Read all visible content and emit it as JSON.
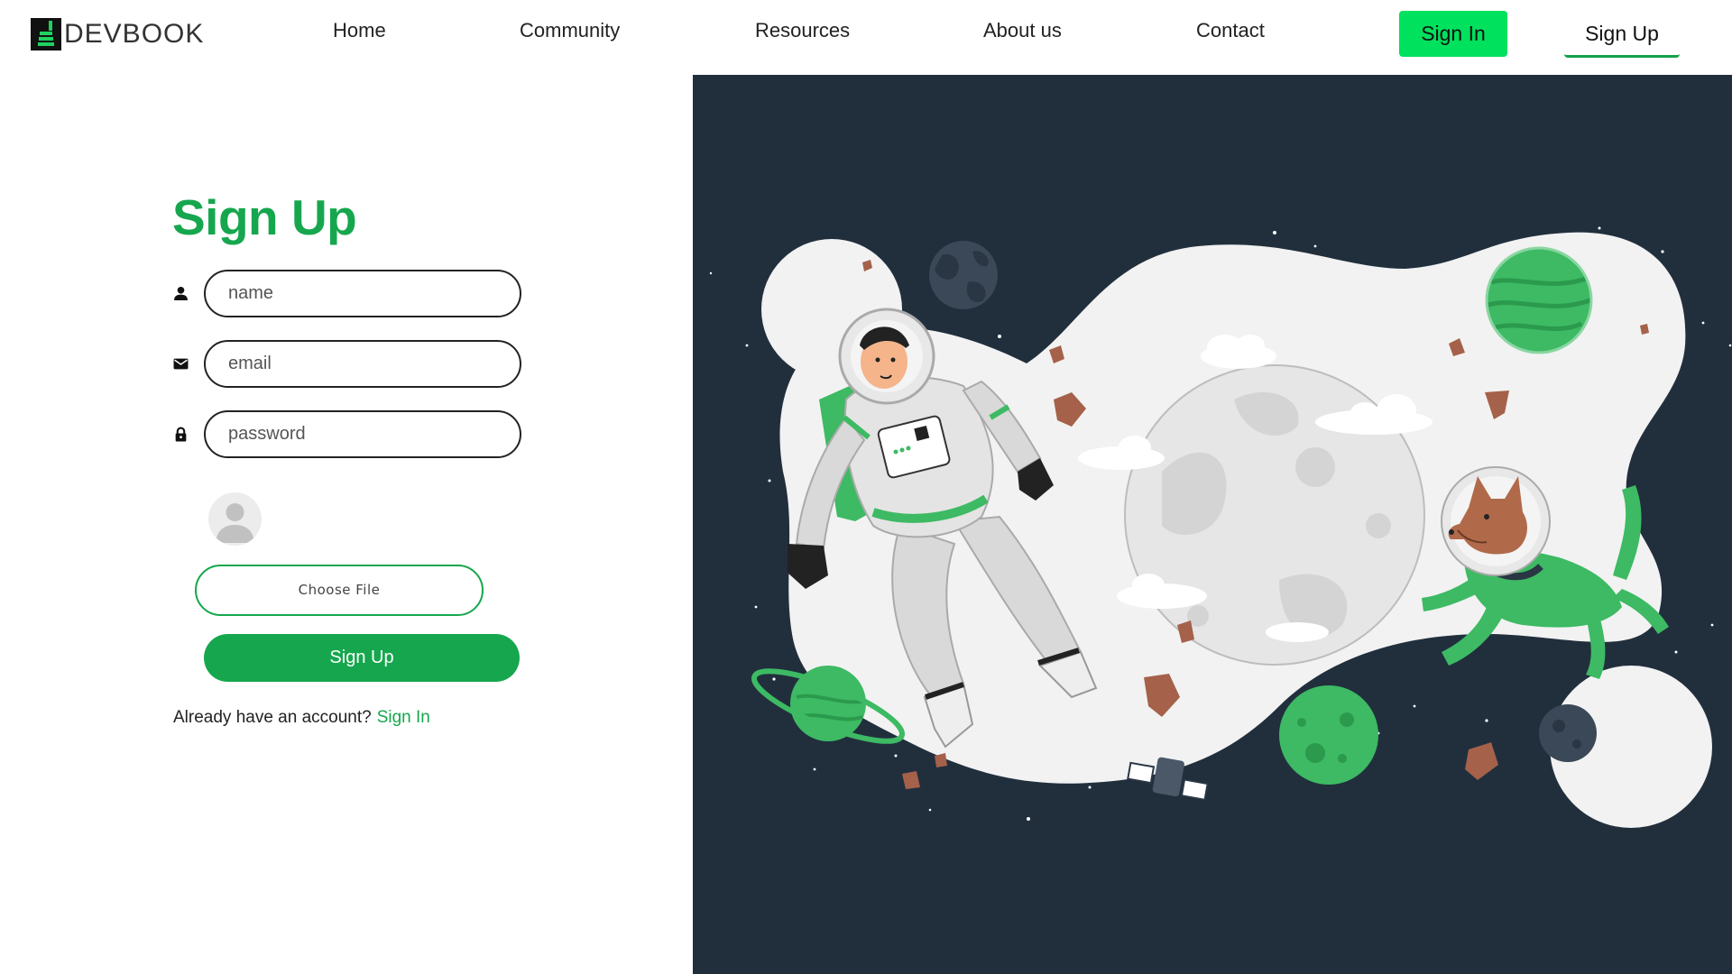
{
  "brand": {
    "name": "DEVBOOK"
  },
  "nav": {
    "links": [
      "Home",
      "Community",
      "Resources",
      "About us",
      "Contact"
    ],
    "signin_label": "Sign In",
    "signup_label": "Sign Up"
  },
  "form": {
    "title": "Sign Up",
    "name_placeholder": "name",
    "email_placeholder": "email",
    "password_placeholder": "password",
    "file_button_label": "Choose File",
    "submit_label": "Sign Up",
    "account_prompt": "Already have an account?",
    "account_link": "Sign In"
  },
  "icons": {
    "name_field": "person-icon",
    "email_field": "envelope-icon",
    "password_field": "lock-icon",
    "avatar": "avatar-placeholder-icon",
    "logo": "devbook-logo-icon"
  },
  "colors": {
    "accent_green": "#16a74e",
    "bright_green": "#00e15d",
    "illustration_bg": "#212f3d"
  }
}
